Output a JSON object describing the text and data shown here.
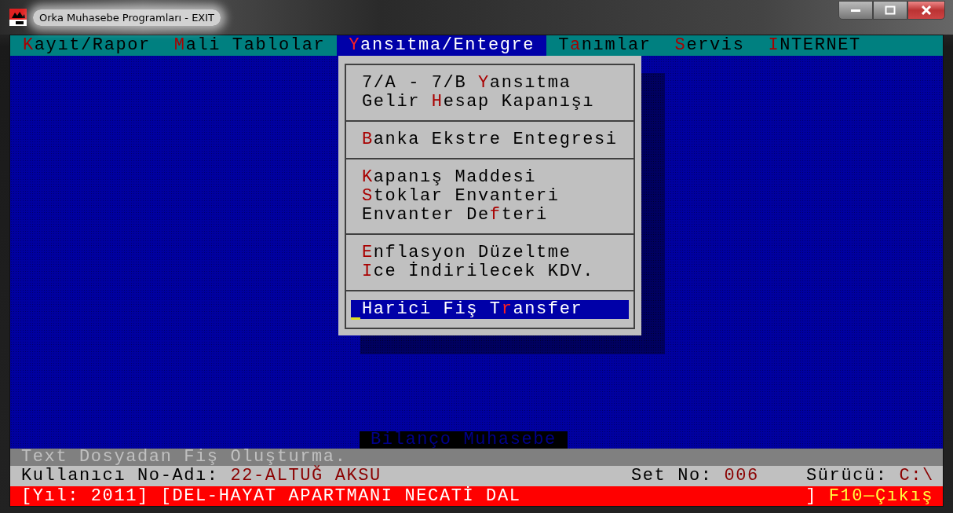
{
  "window": {
    "title": "Orka Muhasebe Programları - EXIT"
  },
  "menu_bar": [
    {
      "key": "K",
      "post": "ayıt/Rapor",
      "selected": false
    },
    {
      "key": "M",
      "post": "ali Tablolar",
      "selected": false
    },
    {
      "key": "Y",
      "post": "ansıtma/Entegre",
      "selected": true
    },
    {
      "pre": "T",
      "key": "a",
      "post": "nımlar",
      "selected": false
    },
    {
      "key": "S",
      "post": "ervis",
      "selected": false
    },
    {
      "key": "I",
      "post": "NTERNET",
      "selected": false
    }
  ],
  "dropdown": {
    "groups": [
      {
        "items": [
          {
            "pre": "7/A - 7/B ",
            "key": "Y",
            "post": "ansıtma",
            "selected": false
          },
          {
            "pre": "Gelir ",
            "key": "H",
            "post": "esap Kapanışı",
            "selected": false
          }
        ]
      },
      {
        "items": [
          {
            "key": "B",
            "post": "anka Ekstre Entegresi",
            "selected": false
          }
        ]
      },
      {
        "items": [
          {
            "key": "K",
            "post": "apanış Maddesi",
            "selected": false
          },
          {
            "key": "S",
            "post": "toklar Envanteri",
            "selected": false
          },
          {
            "pre": "Envanter De",
            "key": "f",
            "post": "teri",
            "selected": false
          }
        ]
      },
      {
        "items": [
          {
            "key": "E",
            "post": "nflasyon Düzeltme",
            "selected": false
          },
          {
            "key": "I",
            "post": "ce İndirilecek KDV.",
            "selected": false
          }
        ]
      },
      {
        "items": [
          {
            "pre": "Harici Fiş T",
            "key": "r",
            "post": "ansfer",
            "selected": true
          }
        ]
      }
    ]
  },
  "background_caption": "Bilanço Muhasebe",
  "hint_line": "Text Dosyadan Fiş Oluşturma.",
  "info_line": {
    "user_label": "Kullanıcı No-Adı:",
    "user_value": "22-ALTUĞ AKSU",
    "set_label": "Set No:",
    "set_value": "006",
    "drive_label": "Sürücü:",
    "drive_value": "C:\\"
  },
  "footer": {
    "company": "[Yıl: 2011] [DEL-HAYAT APARTMANI NECATİ DAL",
    "bracket": "]",
    "exit_key": "F10—Çıkış"
  }
}
